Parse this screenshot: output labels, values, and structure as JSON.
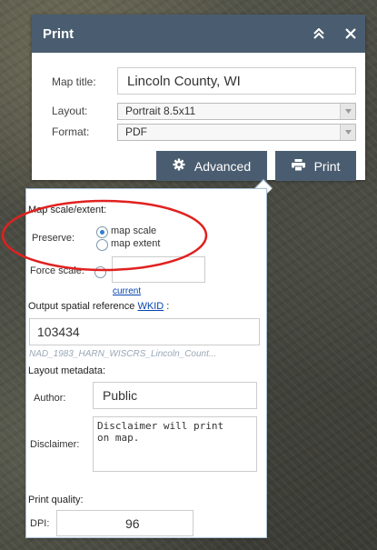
{
  "dialog": {
    "title": "Print",
    "map_title_label": "Map title:",
    "map_title_value": "Lincoln County, WI",
    "layout_label": "Layout:",
    "layout_value": "Portrait 8.5x11",
    "format_label": "Format:",
    "format_value": "PDF",
    "advanced_button": "Advanced",
    "print_button": "Print"
  },
  "advanced": {
    "map_scale_extent_label": "Map scale/extent:",
    "preserve_label": "Preserve:",
    "preserve_options": [
      "map scale",
      "map extent"
    ],
    "force_scale_label": "Force scale:",
    "current_link": "current",
    "output_sr_label": "Output spatial reference",
    "wkid_link": "WKID",
    "colon": ":",
    "wkid_value": "103434",
    "sr_name": "NAD_1983_HARN_WISCRS_Lincoln_Count...",
    "layout_metadata_label": "Layout metadata:",
    "author_label": "Author:",
    "author_value": "Public",
    "disclaimer_label": "Disclaimer:",
    "disclaimer_value": "Disclaimer will print\non map.",
    "print_quality_label": "Print quality:",
    "dpi_label": "DPI:",
    "dpi_value": "96"
  },
  "colors": {
    "header": "#4a5d70",
    "annotation": "#e0211f",
    "radio_selected": "#2f7fd0",
    "link": "#0645ad"
  },
  "icons": {
    "collapse": "double-chevron-up-icon",
    "close": "close-icon",
    "advanced": "gear-icon",
    "print": "printer-icon"
  }
}
